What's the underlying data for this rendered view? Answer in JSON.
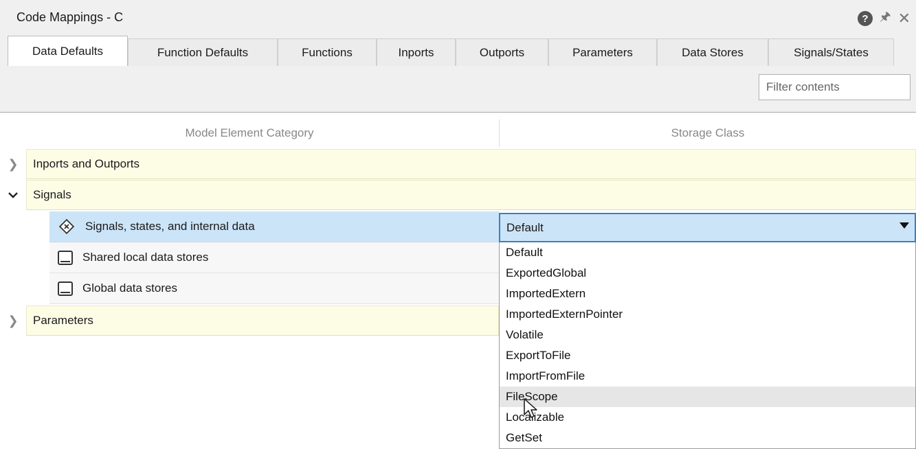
{
  "window": {
    "title": "Code Mappings - C"
  },
  "tabs": [
    {
      "label": "Data Defaults",
      "active": true
    },
    {
      "label": "Function Defaults",
      "active": false
    },
    {
      "label": "Functions",
      "active": false
    },
    {
      "label": "Inports",
      "active": false
    },
    {
      "label": "Outports",
      "active": false
    },
    {
      "label": "Parameters",
      "active": false
    },
    {
      "label": "Data Stores",
      "active": false
    },
    {
      "label": "Signals/States",
      "active": false
    }
  ],
  "filter": {
    "placeholder": "Filter contents",
    "value": ""
  },
  "columns": {
    "category": "Model Element Category",
    "storage": "Storage Class"
  },
  "groups": [
    {
      "label": "Inports and Outports",
      "expanded": false
    },
    {
      "label": "Signals",
      "expanded": true
    },
    {
      "label": "Parameters",
      "expanded": false
    }
  ],
  "items": [
    {
      "label": "Signals, states, and internal data",
      "icon": "signal-icon",
      "selected": true
    },
    {
      "label": "Shared local data stores",
      "icon": "data-store-icon",
      "selected": false
    },
    {
      "label": "Global data stores",
      "icon": "data-store-icon",
      "selected": false
    }
  ],
  "storage_select": {
    "value": "Default",
    "options": [
      "Default",
      "ExportedGlobal",
      "ImportedExtern",
      "ImportedExternPointer",
      "Volatile",
      "ExportToFile",
      "ImportFromFile",
      "FileScope",
      "Localizable",
      "GetSet"
    ],
    "hovered": "FileScope"
  },
  "colors": {
    "accent": "#3c7fc3",
    "selection": "#cce4f7",
    "group_row": "#fdfde6"
  }
}
